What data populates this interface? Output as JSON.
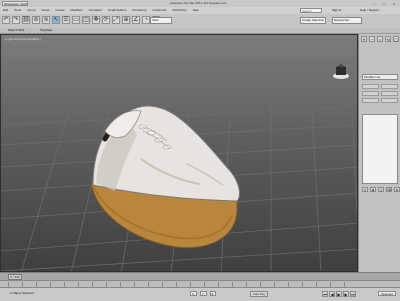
{
  "titlebar": {
    "workspace": "Workspace: Default",
    "title": "Autodesk 3ds Max 2014 x64  Sneaker.max"
  },
  "menubar": {
    "items": [
      "Edit",
      "Tools",
      "Group",
      "Views",
      "Create",
      "Modifiers",
      "Animation",
      "Graph Editors",
      "Rendering",
      "Customize",
      "MAXScript",
      "Help",
      "Dynamics",
      "Interface"
    ],
    "search_placeholder": "Search",
    "user": "Sign In",
    "help": "Help / Support"
  },
  "toolbar": {
    "view_dropdown": "View",
    "named_selection": "Create Selection",
    "named_selection2": "Named Sel"
  },
  "ribbon": {
    "tabs": [
      "Object Paint",
      "Populate"
    ]
  },
  "viewport": {
    "label": "[+] [Perspective] [Realistic]"
  },
  "command_panel": {
    "modifier_list": "Modifier List"
  },
  "timeline": {
    "frame": "0 / 100"
  },
  "statusbar": {
    "selection": "1 Object Selected",
    "x": "X:",
    "y": "Y:",
    "z": "Z:",
    "key": "Auto Key",
    "selected": "Selected"
  },
  "colors": {
    "viewport_top": "#7c7c7c",
    "viewport_bottom": "#3f3f3f",
    "sole": "#b8863c",
    "upper": "#e7e4df"
  }
}
